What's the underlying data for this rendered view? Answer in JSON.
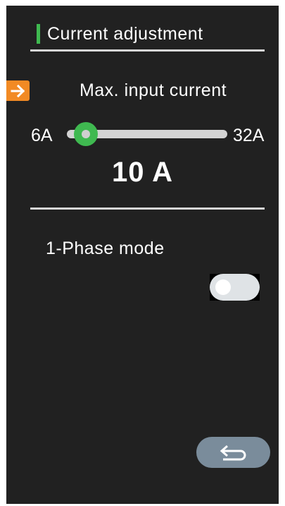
{
  "header": {
    "title": "Current adjustment",
    "accent_color": "#3fb950"
  },
  "current_setting": {
    "indicator_icon": "arrow-right-icon",
    "indicator_color": "#f28a24",
    "label": "Max. input current",
    "min_label": "6A",
    "max_label": "32A",
    "min_value": 6,
    "max_value": 32,
    "value": 10,
    "value_display": "10 A",
    "thumb_color": "#3fb950"
  },
  "phase_mode": {
    "label": "1-Phase mode",
    "enabled": false
  },
  "footer": {
    "back_icon": "return-arrow-icon",
    "back_color": "#7a8c9b"
  }
}
